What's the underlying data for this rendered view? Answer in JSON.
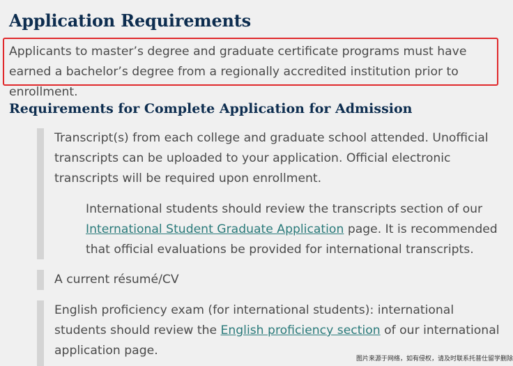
{
  "heading": "Application Requirements",
  "intro": "Applicants to master’s degree and graduate certificate programs must have earned a bachelor’s degree from a regionally accredited institution prior to enrollment.",
  "subheading": "Requirements for Complete Application for Admission",
  "items": [
    {
      "text": "Transcript(s) from each college and graduate school attended. Unofficial transcripts can be uploaded to your application. Official electronic transcripts will be required upon enrollment.",
      "sub": {
        "before": "International students should review the transcripts section of our ",
        "link": "International Student Graduate Application",
        "after": " page. It is recommended that official evaluations be provided for international transcripts."
      }
    },
    {
      "text": "A current résumé/CV"
    },
    {
      "before": "English proficiency exam (for international students): international students should review the ",
      "link": "English proficiency section",
      "after": " of our international application page."
    }
  ],
  "watermark": "图片来源于网络，如有侵权，请及时联系托普仕留学删除",
  "colors": {
    "heading": "#0d2d4f",
    "link": "#2a7a7a",
    "highlight": "#e0282b",
    "bar": "#d4d4d4"
  }
}
